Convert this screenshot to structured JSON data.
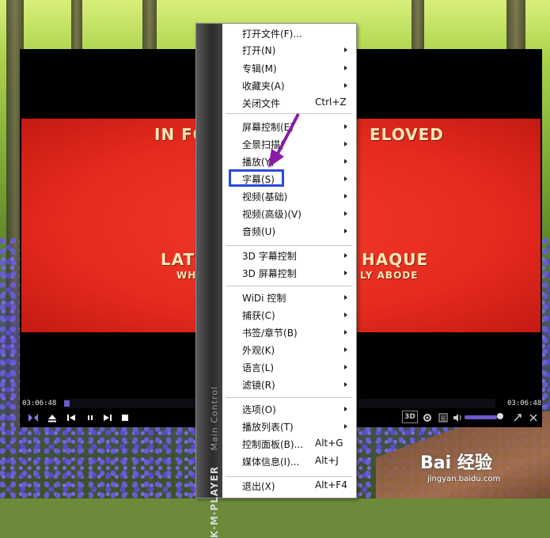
{
  "player": {
    "time_current": "03:06:48",
    "time_total": "03:06:48",
    "progress_fraction": 0.012,
    "volume_fraction": 0.9,
    "badge_3d": "3D"
  },
  "video": {
    "line1_left": "IN FO",
    "line1_right": "ELOVED",
    "line2_left": "LATE",
    "line2_right": "HAQUE",
    "line3_left": "WH",
    "line3_right": "LY ABODE"
  },
  "menu": {
    "strip_title": "K·M·PLAYER",
    "strip_subtitle": "Main Control",
    "items": [
      {
        "label": "打开文件(F)...",
        "shortcut": "",
        "submenu": false
      },
      {
        "label": "打开(N)",
        "shortcut": "",
        "submenu": true
      },
      {
        "label": "专辑(M)",
        "shortcut": "",
        "submenu": true
      },
      {
        "label": "收藏夹(A)",
        "shortcut": "",
        "submenu": true
      },
      {
        "label": "关闭文件",
        "shortcut": "Ctrl+Z",
        "submenu": false
      },
      {
        "label": "屏幕控制(E)",
        "shortcut": "",
        "submenu": true
      },
      {
        "label": "全景扫描(",
        "shortcut": "",
        "submenu": true
      },
      {
        "label": "播放(Y)",
        "shortcut": "",
        "submenu": true
      },
      {
        "label": "字幕(S)",
        "shortcut": "",
        "submenu": true
      },
      {
        "label": "视频(基础)",
        "shortcut": "",
        "submenu": true
      },
      {
        "label": "视频(高级)(V)",
        "shortcut": "",
        "submenu": true
      },
      {
        "label": "音频(U)",
        "shortcut": "",
        "submenu": true
      },
      {
        "label": "3D 字幕控制",
        "shortcut": "",
        "submenu": true
      },
      {
        "label": "3D 屏幕控制",
        "shortcut": "",
        "submenu": true
      },
      {
        "label": "WiDi 控制",
        "shortcut": "",
        "submenu": true
      },
      {
        "label": "捕获(C)",
        "shortcut": "",
        "submenu": true
      },
      {
        "label": "书签/章节(B)",
        "shortcut": "",
        "submenu": true
      },
      {
        "label": "外观(K)",
        "shortcut": "",
        "submenu": true
      },
      {
        "label": "语言(L)",
        "shortcut": "",
        "submenu": true
      },
      {
        "label": "滤镜(R)",
        "shortcut": "",
        "submenu": true
      },
      {
        "label": "选项(O)",
        "shortcut": "",
        "submenu": true
      },
      {
        "label": "播放列表(T)",
        "shortcut": "",
        "submenu": true
      },
      {
        "label": "控制面板(B)...",
        "shortcut": "Alt+G",
        "submenu": false
      },
      {
        "label": "媒体信息(I)...",
        "shortcut": "Alt+J",
        "submenu": false
      },
      {
        "label": "退出(X)",
        "shortcut": "Alt+F4",
        "submenu": false
      }
    ]
  },
  "watermark": {
    "brand": "Bai 经验",
    "url": "jingyan.baidu.com"
  },
  "colors": {
    "highlight_box": "#2a4ad8",
    "annotation_arrow": "#8a1aa8",
    "accent": "#6a5ad0"
  }
}
